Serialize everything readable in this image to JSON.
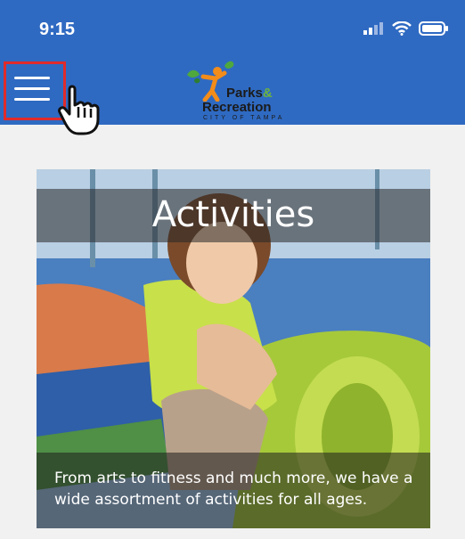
{
  "status_bar": {
    "time": "9:15"
  },
  "header": {
    "menu_label": "menu",
    "logo": {
      "line1": "Parks",
      "amp": "&",
      "line2": "Recreation",
      "line3": "CITY OF TAMPA"
    }
  },
  "card": {
    "title": "Activities",
    "caption": "From arts to fitness and much more, we have a wide assortment of activities for all ages."
  },
  "colors": {
    "header_bg": "#2f6ac2",
    "highlight": "#e02b2b",
    "page_bg": "#f1f1f1"
  }
}
